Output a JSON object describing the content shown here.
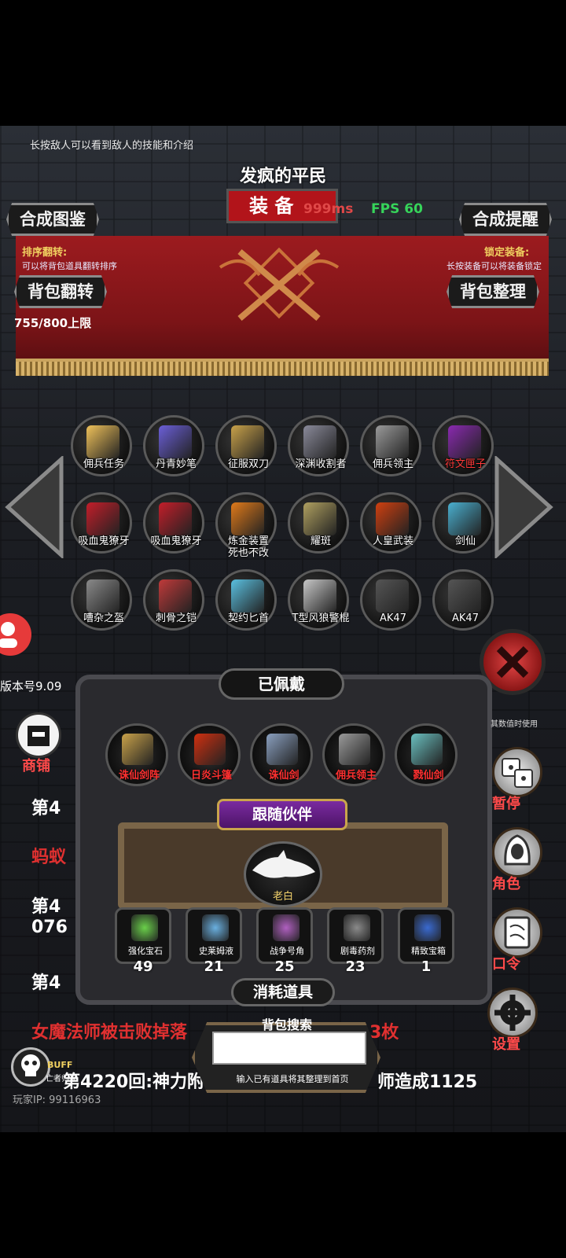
{
  "hint": "长按敌人可以看到敌人的技能和介绍",
  "title": {
    "enemy": "发疯的平民",
    "main": "装 备"
  },
  "stats": {
    "ping": "999ms",
    "fps": "FPS 60"
  },
  "buttons": {
    "compose_book": "合成图鉴",
    "compose_remind": "合成提醒",
    "bag_flip": "背包翻转",
    "bag_sort": "背包整理"
  },
  "labels": {
    "sort_flip": "排序翻转:",
    "sort_flip_note": "可以将背包道具翻转排序",
    "lock_equip": "锁定装备:",
    "lock_equip_note": "长按装备可以将装备锁定",
    "capacity": "755/800上限",
    "version": "版本号9.09"
  },
  "items": [
    {
      "label": "佣兵任务",
      "color": "#f0c25a",
      "red": false
    },
    {
      "label": "丹青妙笔",
      "color": "#6b5fd8",
      "red": false
    },
    {
      "label": "征服双刀",
      "color": "#c9a24a",
      "red": false
    },
    {
      "label": "深渊收割者",
      "color": "#8a8a9a",
      "red": false
    },
    {
      "label": "佣兵领主",
      "color": "#9a9a9a",
      "red": false
    },
    {
      "label": "符文匣子",
      "color": "#8a2ab0",
      "red": true
    },
    {
      "label": "吸血鬼獠牙",
      "color": "#c41e2a",
      "red": false
    },
    {
      "label": "吸血鬼獠牙",
      "color": "#c41e2a",
      "red": false
    },
    {
      "label": "炼金装置\n死也不改",
      "color": "#e07a1a",
      "red": false
    },
    {
      "label": "耀斑",
      "color": "#b0a060",
      "red": false
    },
    {
      "label": "人皇武装",
      "color": "#d04010",
      "red": false
    },
    {
      "label": "剑仙",
      "color": "#4ab0d0",
      "red": false
    },
    {
      "label": "嘈杂之盔",
      "color": "#8a8a8a",
      "red": false
    },
    {
      "label": "刺骨之铠",
      "color": "#c03a3a",
      "red": false
    },
    {
      "label": "契约匕首",
      "color": "#5ac0e0",
      "red": false
    },
    {
      "label": "T型风狼警棍",
      "color": "#c8c8c8",
      "red": false
    },
    {
      "label": "AK47",
      "color": "#555555",
      "red": false
    },
    {
      "label": "AK47",
      "color": "#555555",
      "red": false
    }
  ],
  "equipped": {
    "title": "已佩戴",
    "items": [
      {
        "label": "诛仙剑阵",
        "color": "#c9a24a"
      },
      {
        "label": "日炎斗篷",
        "color": "#d03010"
      },
      {
        "label": "诛仙剑",
        "color": "#8aa0c0"
      },
      {
        "label": "佣兵领主",
        "color": "#9a9a9a"
      },
      {
        "label": "戮仙剑",
        "color": "#6ac0c0"
      }
    ]
  },
  "follow": {
    "title": "跟随伙伴",
    "pet": "老白"
  },
  "consumables": {
    "title": "消耗道具",
    "items": [
      {
        "label": "强化宝石",
        "count": "49",
        "color": "#6ad04a"
      },
      {
        "label": "史莱姆液",
        "count": "21",
        "color": "#6ab0e0"
      },
      {
        "label": "战争号角",
        "count": "25",
        "color": "#b060c0"
      },
      {
        "label": "剧毒药剂",
        "count": "23",
        "color": "#8a8a8a"
      },
      {
        "label": "精致宝箱",
        "count": "1",
        "color": "#3a6ad0"
      }
    ]
  },
  "search": {
    "title": "背包搜索",
    "placeholder": "",
    "hint": "输入已有道具将其整理到首页"
  },
  "side": {
    "shop": "商铺",
    "pause": "暂停",
    "role": "角色",
    "code": "口令",
    "settings": "设置",
    "other_note": "其数值时使用"
  },
  "log": {
    "line1": "第4",
    "line2": "蚂蚁",
    "line3": "第4",
    "line3b": "076",
    "line4": "第4",
    "line5": "女魔法师被击败掉落",
    "line5b": "3枚",
    "line6": "第4220回:神力附体",
    "line6b": "师造成1125",
    "player_ip": "玩家IP: 99116963",
    "buff": "BUFF",
    "buff_sub": "亡者归来"
  }
}
